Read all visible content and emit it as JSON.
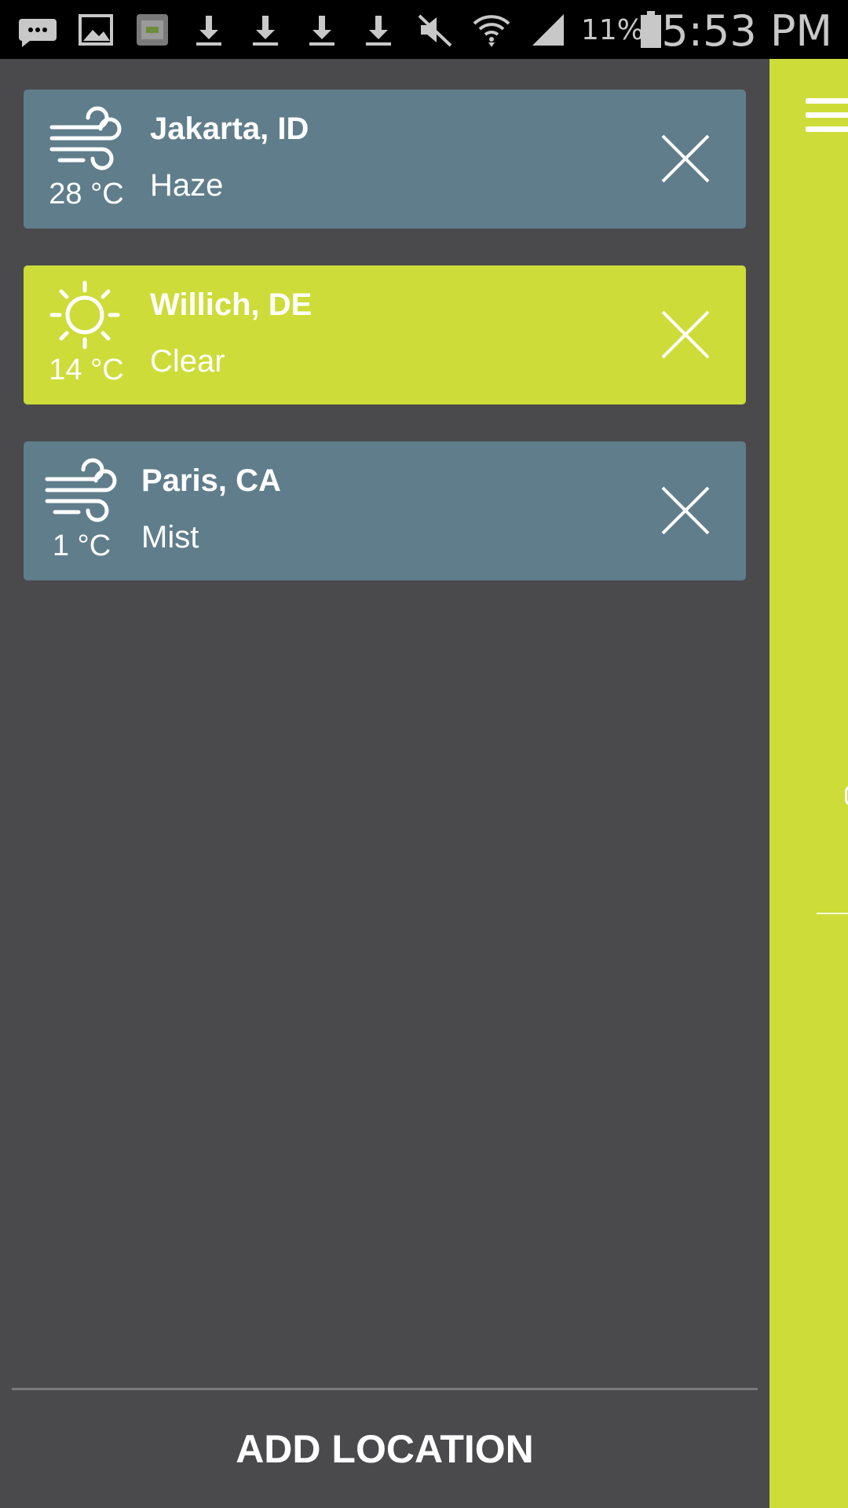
{
  "status_bar": {
    "icons": [
      "messaging-icon",
      "gallery-icon",
      "app-notification-icon",
      "download-icon",
      "download-icon",
      "download-icon",
      "download-icon",
      "mute-icon",
      "wifi-icon",
      "cellular-signal-icon"
    ],
    "battery_percent": "11%",
    "battery_icon": "battery-icon",
    "time": "5:53 PM"
  },
  "colors": {
    "drawer_background": "#4a4a4c",
    "card_slate": "#607d8b",
    "card_lime": "#cddc39",
    "text": "#ffffff"
  },
  "locations": [
    {
      "city": "Jakarta, ID",
      "condition": "Haze",
      "temperature": "28 °C",
      "icon": "wind-icon",
      "color": "#607d8b"
    },
    {
      "city": "Willich, DE",
      "condition": "Clear",
      "temperature": "14 °C",
      "icon": "sun-icon",
      "color": "#cddc39"
    },
    {
      "city": "Paris, CA",
      "condition": "Mist",
      "temperature": "1 °C",
      "icon": "wind-icon",
      "color": "#607d8b"
    }
  ],
  "drawer": {
    "add_location_label": "ADD LOCATION"
  },
  "main_screen": {
    "menu_icon": "hamburger-menu-icon"
  }
}
